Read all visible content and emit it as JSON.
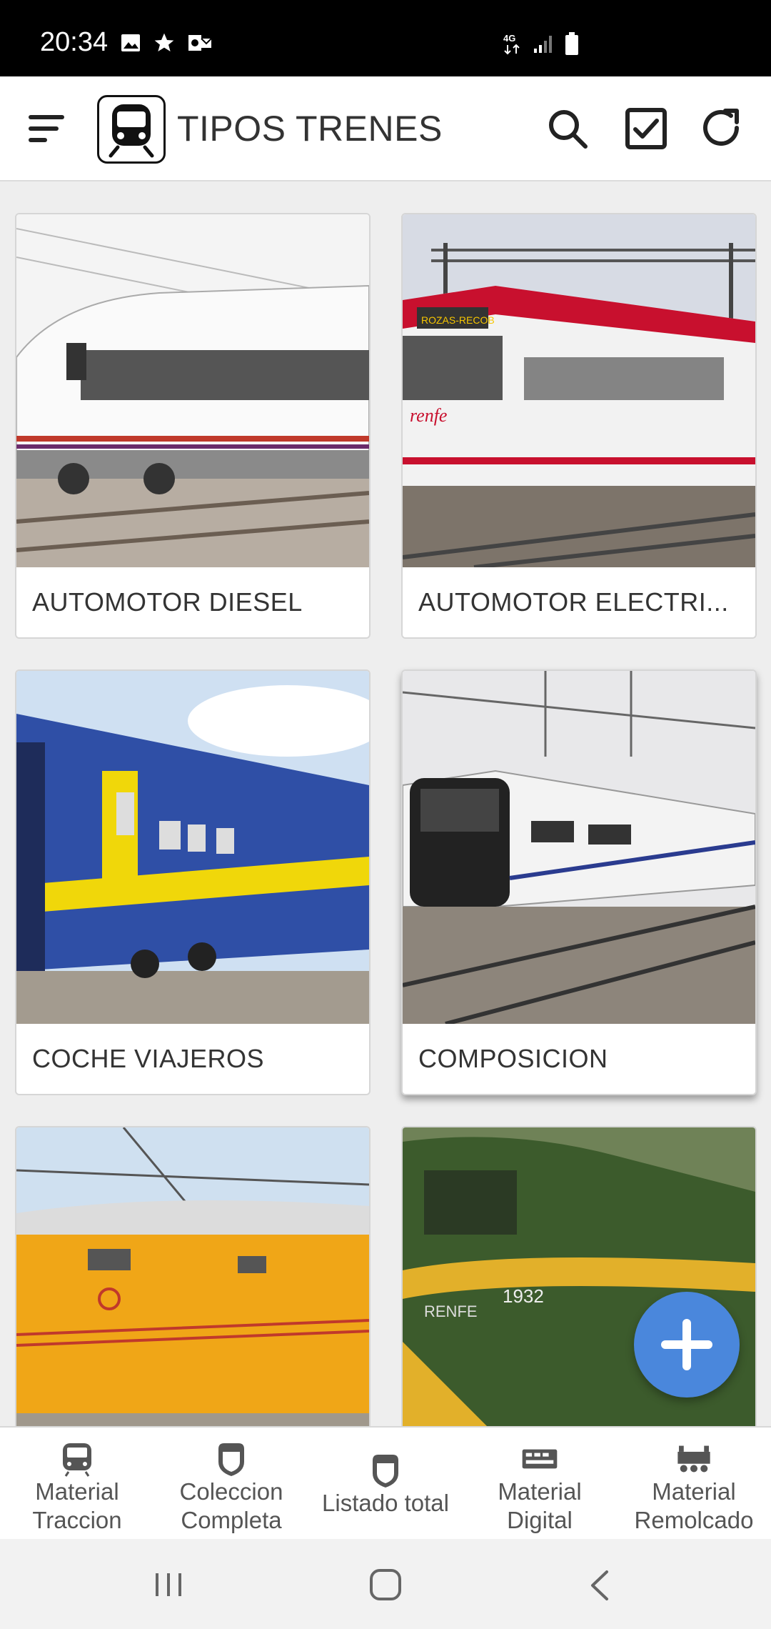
{
  "status_bar": {
    "time": "20:34",
    "network": "4G"
  },
  "app_bar": {
    "title": "TIPOS TRENES",
    "logo_icon": "train-icon",
    "actions": [
      "search-icon",
      "checkbox-icon",
      "refresh-icon"
    ]
  },
  "cards": [
    {
      "label": "AUTOMOTOR DIESEL"
    },
    {
      "label": "AUTOMOTOR ELECTRI..."
    },
    {
      "label": "COCHE VIAJEROS"
    },
    {
      "label": "COMPOSICION"
    },
    {
      "label": ""
    },
    {
      "label": ""
    }
  ],
  "fab": {
    "icon": "plus-icon"
  },
  "bottom_nav": {
    "items": [
      {
        "label": "Material\nTraccion",
        "icon": "locomotive-icon"
      },
      {
        "label": "Coleccion\nCompleta",
        "icon": "shield-icon"
      },
      {
        "label": "Listado total",
        "icon": "shield-icon"
      },
      {
        "label": "Material\nDigital",
        "icon": "digital-card-icon"
      },
      {
        "label": "Material\nRemolcado",
        "icon": "wagon-icon"
      }
    ]
  },
  "colors": {
    "accent": "#4a87dc",
    "status_bar": "#000000",
    "background": "#eeeeee"
  }
}
